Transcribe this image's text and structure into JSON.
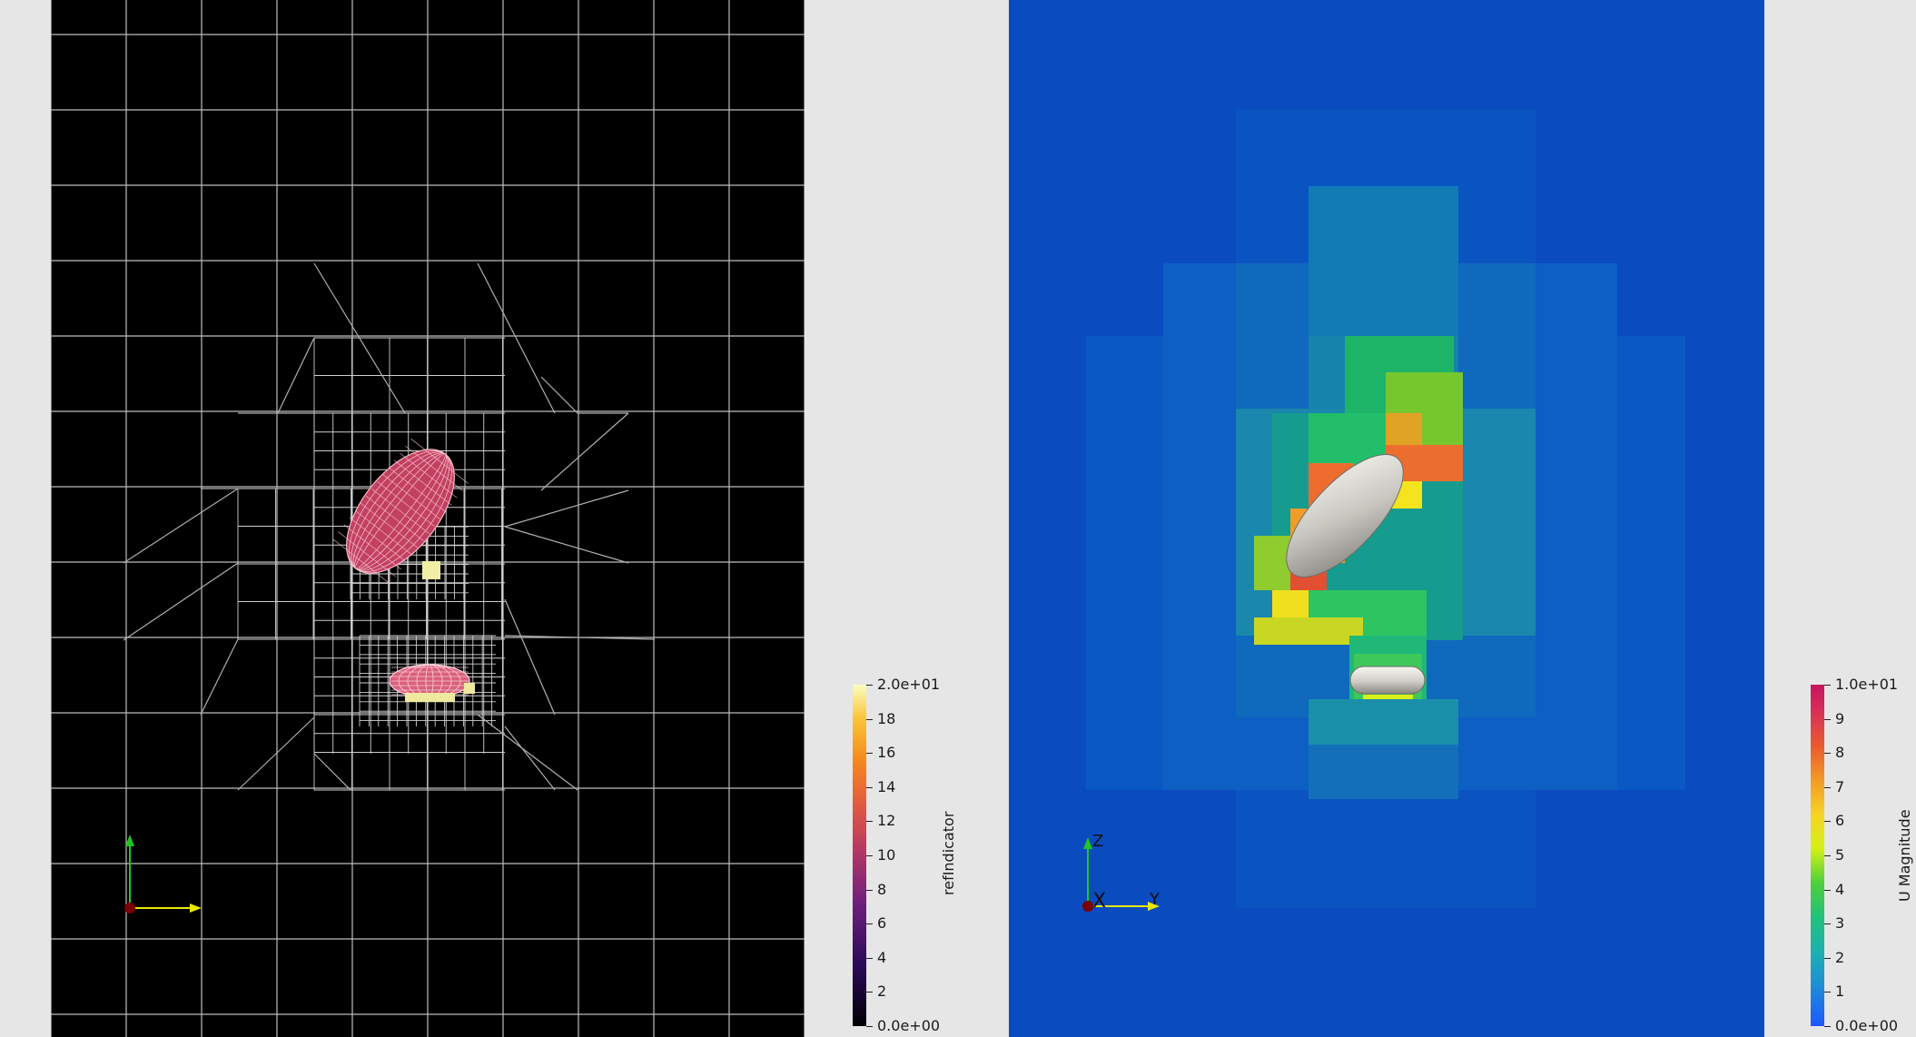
{
  "left_view": {
    "scalar_bar": {
      "title": "refIndicator",
      "labels": [
        "2.0e+01",
        "18",
        "16",
        "14",
        "12",
        "10",
        "8",
        "6",
        "4",
        "2",
        "0.0e+00"
      ]
    }
  },
  "right_view": {
    "scalar_bar": {
      "title": "U Magnitude",
      "labels": [
        "1.0e+01",
        "9",
        "8",
        "7",
        "6",
        "5",
        "4",
        "3",
        "2",
        "1",
        "0.0e+00"
      ]
    },
    "orientation_axes": {
      "z": "Z",
      "x": "X",
      "y": "Y"
    }
  },
  "colors": {
    "background": "#e6e6e6",
    "mesh_background": "#000000",
    "field_background": "#0a4bc0",
    "mesh_lines": "#cfcfcf",
    "particle_wire": "#e0506e"
  }
}
